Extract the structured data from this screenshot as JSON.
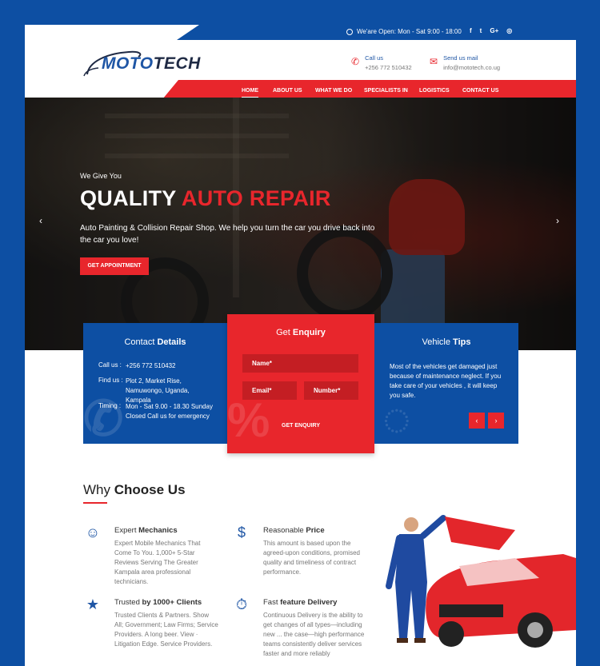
{
  "topbar": {
    "hours": "We'are Open: Mon - Sat 9:00 - 18:00",
    "socials": [
      "f",
      "t",
      "G+",
      "ig"
    ]
  },
  "header": {
    "logo_part1": "MOTO",
    "logo_part2": "TECH",
    "call_label": "Call us",
    "call_value": "+256 772 510432",
    "mail_label": "Send us mail",
    "mail_value": "info@mototech.co.ug"
  },
  "nav": {
    "items": [
      "HOME",
      "ABOUT US",
      "WHAT WE DO",
      "SPECIALISTS IN",
      "LOGISTICS",
      "CONTACT US"
    ],
    "active": "HOME"
  },
  "hero": {
    "pretitle": "We Give You",
    "title_white": "QUALITY ",
    "title_red": "AUTO REPAIR",
    "description": "Auto Painting & Collision Repair Shop. We help you turn the car you drive back into the car you love!",
    "cta": "GET APPOINTMENT",
    "prev": "‹",
    "next": "›"
  },
  "contact_card": {
    "title_light": "Contact ",
    "title_bold": "Details",
    "rows": [
      {
        "key": "Call us :",
        "value": "+256 772 510432"
      },
      {
        "key": "Find us :",
        "value": "Plot 2, Market Rise, Namuwongo, Uganda, Kampala"
      },
      {
        "key": "Timing :",
        "value": "Mon - Sat 9.00 - 18.30 Sunday Closed Call us for emergency"
      }
    ]
  },
  "enquiry_card": {
    "title_light": "Get ",
    "title_bold": "Enquiry",
    "name_placeholder": "Name*",
    "email_placeholder": "Email*",
    "number_placeholder": "Number*",
    "button": "GET ENQUIRY"
  },
  "tips_card": {
    "title_light": "Vehicle ",
    "title_bold": "Tips",
    "text": "Most of the vehicles get damaged just because of maintenance neglect. If you take care of your vehicles , it will keep you safe.",
    "prev": "‹",
    "next": "›"
  },
  "why": {
    "title_light": "Why ",
    "title_bold": "Choose Us",
    "features": [
      {
        "icon": "mechanic-icon",
        "title_light": "Expert ",
        "title_bold": "Mechanics",
        "text": "Expert Mobile Mechanics That Come To You. 1,000+ 5-Star Reviews Serving The Greater Kampala area professional technicians."
      },
      {
        "icon": "price-icon",
        "title_light": "Reasonable ",
        "title_bold": "Price",
        "text": "This amount is based upon the agreed-upon conditions, promised quality and timeliness of contract performance."
      },
      {
        "icon": "clients-icon",
        "title_light": "Trusted ",
        "title_bold": "by 1000+ Clients",
        "text": "Trusted Clients & Partners. Show All; Government; Law Firms; Service Providers. A long beer. View · Litigation Edge. Service Providers."
      },
      {
        "icon": "delivery-icon",
        "title_light": "Fast ",
        "title_bold": "feature Delivery",
        "text": "Continuous Delivery is the ability to get changes of all types—including new ... the case—high performance teams consistently deliver services faster and more reliably"
      }
    ]
  },
  "colors": {
    "brand_blue": "#0d4fa3",
    "brand_red": "#e8262c"
  }
}
